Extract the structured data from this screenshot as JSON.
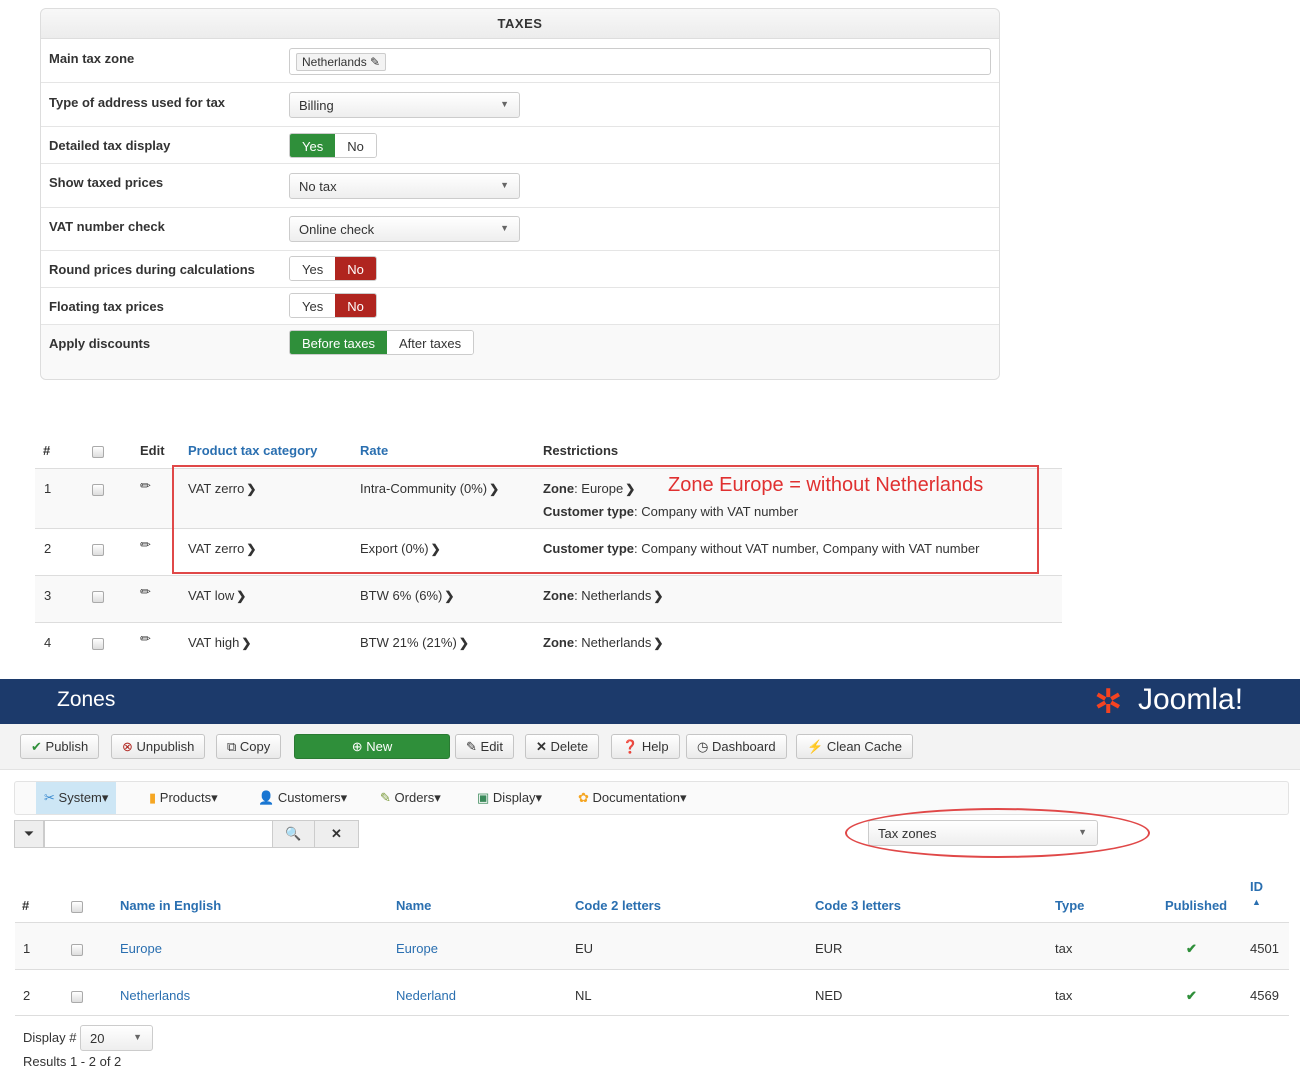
{
  "taxes": {
    "title": "TAXES",
    "rows": [
      {
        "label": "Main tax zone",
        "tag": "Netherlands"
      },
      {
        "label": "Type of address used for tax",
        "value": "Billing"
      },
      {
        "label": "Detailed tax display",
        "options": [
          "Yes",
          "No"
        ],
        "selected": "Yes"
      },
      {
        "label": "Show taxed prices",
        "value": "No tax"
      },
      {
        "label": "VAT number check",
        "value": "Online check"
      },
      {
        "label": "Round prices during calculations",
        "options": [
          "Yes",
          "No"
        ],
        "selected": "No"
      },
      {
        "label": "Floating tax prices",
        "options": [
          "Yes",
          "No"
        ],
        "selected": "No"
      },
      {
        "label": "Apply discounts",
        "options": [
          "Before taxes",
          "After taxes"
        ],
        "selected": "Before taxes"
      }
    ]
  },
  "rules": {
    "headers": {
      "num": "#",
      "edit": "Edit",
      "category": "Product tax category",
      "rate": "Rate",
      "restrictions": "Restrictions"
    },
    "annotation": "Zone Europe = without Netherlands",
    "rows": [
      {
        "num": "1",
        "category": "VAT zerro",
        "rate": "Intra-Community (0%)",
        "r1k": "Zone",
        "r1v": ": Europe",
        "r2k": "Customer type",
        "r2v": ": Company with VAT number"
      },
      {
        "num": "2",
        "category": "VAT zerro",
        "rate": "Export (0%)",
        "r1k": "Customer type",
        "r1v": ": Company without VAT number, Company with VAT number"
      },
      {
        "num": "3",
        "category": "VAT low",
        "rate": "BTW 6% (6%)",
        "r1k": "Zone",
        "r1v": ": Netherlands"
      },
      {
        "num": "4",
        "category": "VAT high",
        "rate": "BTW 21% (21%)",
        "r1k": "Zone",
        "r1v": ": Netherlands"
      }
    ]
  },
  "zones": {
    "title": "Zones",
    "logo": "Joomla!",
    "toolbar": [
      "Publish",
      "Unpublish",
      "Copy",
      "New",
      "Edit",
      "Delete",
      "Help",
      "Dashboard",
      "Clean Cache"
    ],
    "menu": [
      "System",
      "Products",
      "Customers",
      "Orders",
      "Display",
      "Documentation"
    ],
    "filter": {
      "search_value": "",
      "type_select": "Tax zones"
    },
    "headers": {
      "num": "#",
      "name_en": "Name in English",
      "name": "Name",
      "code2": "Code 2 letters",
      "code3": "Code 3 letters",
      "type": "Type",
      "published": "Published",
      "id": "ID"
    },
    "rows": [
      {
        "num": "1",
        "name_en": "Europe",
        "name": "Europe",
        "code2": "EU",
        "code3": "EUR",
        "type": "tax",
        "published": "✔",
        "id": "4501"
      },
      {
        "num": "2",
        "name_en": "Netherlands",
        "name": "Nederland",
        "code2": "NL",
        "code3": "NED",
        "type": "tax",
        "published": "✔",
        "id": "4569"
      }
    ],
    "display_label": "Display #",
    "display_value": "20",
    "results": "Results 1 - 2 of 2"
  },
  "colors": {
    "navy": "#1c3a6b",
    "green": "#2f8f3a",
    "red": "#b0251f",
    "annotation": "#e03030"
  }
}
